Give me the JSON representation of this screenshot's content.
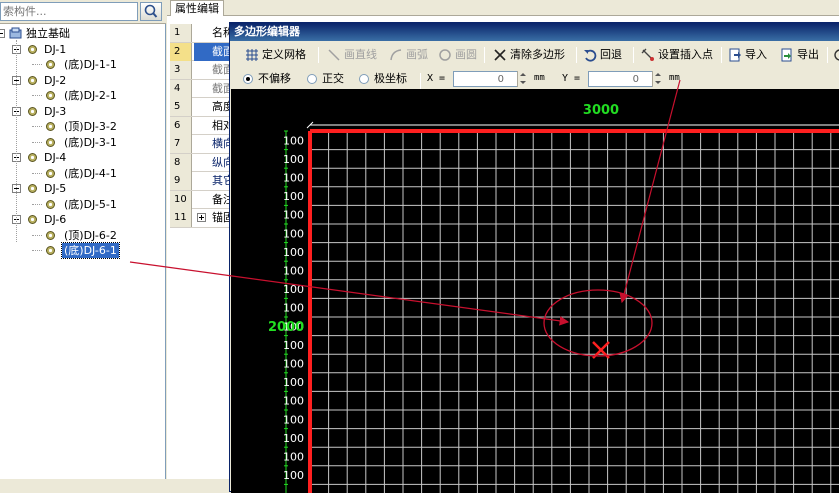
{
  "search": {
    "placeholder": "索构件...",
    "value": "索构件..."
  },
  "tree": {
    "root": "独立基础",
    "groups": [
      {
        "label": "DJ-1",
        "children": [
          "(底)DJ-1-1"
        ]
      },
      {
        "label": "DJ-2",
        "children": [
          "(底)DJ-2-1"
        ]
      },
      {
        "label": "DJ-3",
        "children": [
          "(顶)DJ-3-2",
          "(底)DJ-3-1"
        ]
      },
      {
        "label": "DJ-4",
        "children": [
          "(底)DJ-4-1"
        ]
      },
      {
        "label": "DJ-5",
        "children": [
          "(底)DJ-5-1"
        ]
      },
      {
        "label": "DJ-6",
        "children": [
          "(顶)DJ-6-2",
          "(底)DJ-6-1"
        ]
      }
    ],
    "selected": "(底)DJ-6-1"
  },
  "property_panel": {
    "tab_label": "属性编辑",
    "rows": [
      {
        "num": "1",
        "name": "名称"
      },
      {
        "num": "2",
        "name": "截面"
      },
      {
        "num": "3",
        "name": "截面"
      },
      {
        "num": "4",
        "name": "截面"
      },
      {
        "num": "5",
        "name": "高度"
      },
      {
        "num": "6",
        "name": "相对"
      },
      {
        "num": "7",
        "name": "横向"
      },
      {
        "num": "8",
        "name": "纵向"
      },
      {
        "num": "9",
        "name": "其它"
      },
      {
        "num": "10",
        "name": "备注"
      },
      {
        "num": "11",
        "name": "锚固"
      }
    ]
  },
  "editor": {
    "title": "多边形编辑器",
    "toolbar": {
      "define_grid": "定义网格",
      "draw_line": "画直线",
      "draw_arc": "画弧",
      "draw_circle": "画圆",
      "clear_polygon": "清除多边形",
      "undo": "回退",
      "set_insert_point": "设置插入点",
      "import": "导入",
      "export": "导出"
    },
    "options": {
      "no_offset": "不偏移",
      "orthogonal": "正交",
      "polar": "极坐标",
      "x_label": "X =",
      "x_value": "0",
      "y_label": "Y =",
      "y_value": "0",
      "unit": "mm"
    },
    "canvas": {
      "top_dimension": "3000",
      "left_dimension": "2000",
      "row_spacing_label": "100",
      "grid_color": "#c8c8c8",
      "boundary_color": "#ff2020",
      "dimension_color": "#22dd22"
    }
  },
  "annotation_color": "#c8102e"
}
